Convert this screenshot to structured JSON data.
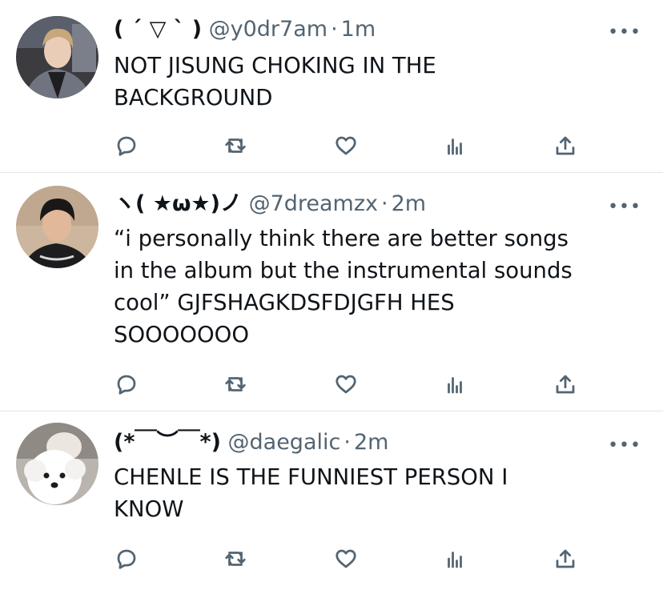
{
  "tweets": [
    {
      "display_name": "( ´ ▽ ` )",
      "handle": "@y0dr7am",
      "separator": "·",
      "time": "1m",
      "more": "•••",
      "text": "NOT JISUNG CHOKING IN THE\nBACKGROUND",
      "avatar": "person-avatar"
    },
    {
      "display_name": "ヽ( ★ω★)ノ",
      "handle": "@7dreamzx",
      "separator": "·",
      "time": "2m",
      "more": "•••",
      "text": "“i personally think there are better songs\nin the album but the instrumental sounds\ncool” GJFSHAGKDSFDJGFH HES\nSOOOOOOO",
      "avatar": "person-avatar"
    },
    {
      "display_name": "(*￣︶￣*)",
      "handle": "@daegalic",
      "separator": "·",
      "time": "2m",
      "more": "•••",
      "text": "CHENLE IS THE FUNNIEST PERSON I\nKNOW",
      "avatar": "dog-avatar"
    }
  ],
  "actions": [
    "reply-icon",
    "retweet-icon",
    "like-icon",
    "analytics-icon",
    "share-icon"
  ],
  "colors": {
    "secondary_text": "#536471",
    "primary_text": "#0f1419",
    "divider": "#e1e4e7"
  }
}
